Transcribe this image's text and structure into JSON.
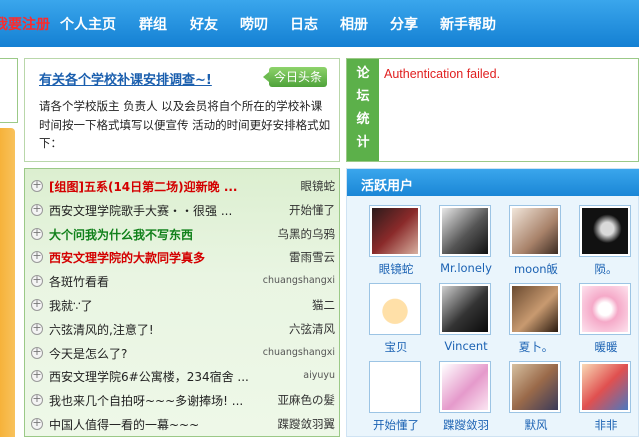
{
  "nav": {
    "items": [
      "我要注册",
      "个人主页",
      "群组",
      "好友",
      "唠叨",
      "日志",
      "相册",
      "分享",
      "新手帮助"
    ],
    "active_index": 0
  },
  "headline": {
    "title": "有关各个学校补课安排调查~!",
    "badge": "今日头条",
    "body": "请各个学校版主 负责人 以及会员将自个所在的学校补课时间按一下格式填写以便宣传 活动的时间更好安排格式如下："
  },
  "stats": {
    "label": "论坛统计",
    "label_chars": [
      "论",
      "坛",
      "统",
      "计"
    ],
    "error": "Authentication failed."
  },
  "posts": [
    {
      "title": "[组图]五系(14日第二场)迎新晚 ...",
      "author": "眼镜蛇",
      "style": "red"
    },
    {
      "title": "西安文理学院歌手大赛・・很强 ...",
      "author": "开始懂了",
      "style": ""
    },
    {
      "title": "大个问我为什么我不写东西",
      "author": "乌黑的乌鸦",
      "style": "green"
    },
    {
      "title": "西安文理学院的大款同学真多",
      "author": "雷雨雪云",
      "style": "red"
    },
    {
      "title": "各斑竹看看",
      "author": "chuangshangxi",
      "style": "",
      "author_small": true
    },
    {
      "title": "我就∵了",
      "author": "猫二",
      "style": ""
    },
    {
      "title": "六弦清风的,注意了!",
      "author": "六弦清风",
      "style": ""
    },
    {
      "title": "今天是怎么了?",
      "author": "chuangshangxi",
      "style": "",
      "author_small": true
    },
    {
      "title": "西安文理学院6#公寓楼，234宿舍 ...",
      "author": "aiyuyu",
      "style": "",
      "author_small": true
    },
    {
      "title": "我也来几个自拍呀~~~多谢捧场! ...",
      "author": "亚麻色の髮",
      "style": ""
    },
    {
      "title": "中国人值得一看的一幕~~~",
      "author": "蹀躞敛羽翼",
      "style": ""
    }
  ],
  "users": {
    "header": "活跃用户",
    "list": [
      {
        "name": "眼镜蛇",
        "photo": "portrait-girl-red"
      },
      {
        "name": "Mr.lonely",
        "photo": "portrait-bw-couple"
      },
      {
        "name": "moon皈",
        "photo": "portrait-child"
      },
      {
        "name": "陨。",
        "photo": "portrait-dark"
      },
      {
        "name": "宝贝",
        "photo": "cartoon-face"
      },
      {
        "name": "Vincent",
        "photo": "portrait-bw-man"
      },
      {
        "name": "夏卜。",
        "photo": "portrait-girl-brown"
      },
      {
        "name": "暖暖",
        "photo": "pink-graphic"
      },
      {
        "name": "开始懂了",
        "photo": "logo-text"
      },
      {
        "name": "蹀躞敛羽",
        "photo": "pink-art"
      },
      {
        "name": "默风",
        "photo": "group-photo"
      },
      {
        "name": "非非",
        "photo": "cartoon-kids"
      }
    ]
  }
}
